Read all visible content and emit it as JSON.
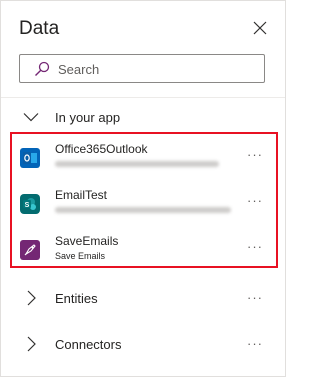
{
  "panel": {
    "title": "Data",
    "close_icon": "close-icon"
  },
  "search": {
    "placeholder": "Search",
    "value": ""
  },
  "sections": {
    "in_your_app": {
      "label": "In your app",
      "expanded": true
    },
    "entities": {
      "label": "Entities",
      "expanded": false
    },
    "connectors": {
      "label": "Connectors",
      "expanded": false
    }
  },
  "items": [
    {
      "name": "Office365Outlook",
      "subtitle": "",
      "icon": "outlook-icon",
      "icon_color": "#0364b8"
    },
    {
      "name": "EmailTest",
      "subtitle": "",
      "icon": "sharepoint-icon",
      "icon_color": "#036c70"
    },
    {
      "name": "SaveEmails",
      "subtitle": "Save Emails",
      "icon": "flow-icon",
      "icon_color": "#742774"
    }
  ],
  "more_label": "···",
  "colors": {
    "highlight_border": "#e81123",
    "search_icon": "#742774"
  }
}
